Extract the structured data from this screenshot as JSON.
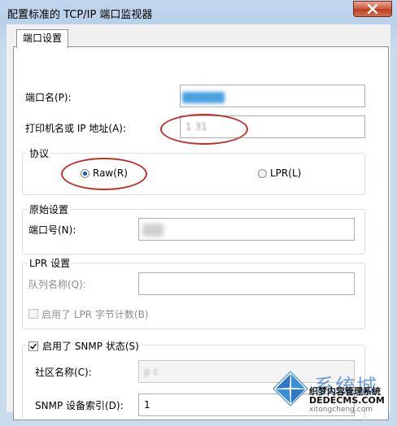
{
  "window": {
    "title": "配置标准的 TCP/IP 端口监视器"
  },
  "tabs": [
    {
      "label": "端口设置"
    }
  ],
  "port_name": {
    "label": "端口名(P):",
    "value": ""
  },
  "printer_address": {
    "label": "打印机名或 IP 地址(A):",
    "value": "1       31"
  },
  "protocol": {
    "title": "协议",
    "raw_label": "Raw(R)",
    "lpr_label": "LPR(L)",
    "selected": "Raw"
  },
  "raw_settings": {
    "title": "原始设置",
    "port_number_label": "端口号(N):",
    "port_number_value": ""
  },
  "lpr_settings": {
    "title": "LPR 设置",
    "queue_name_label": "队列名称(Q):",
    "queue_name_value": "",
    "byte_count_label": "启用了 LPR 字节计数(B)",
    "byte_count_checked": false
  },
  "snmp": {
    "enabled_label": "启用了 SNMP 状态(S)",
    "enabled_checked": true,
    "community_label": "社区名称(C):",
    "community_value": "p     c",
    "device_index_label": "SNMP 设备索引(D):",
    "device_index_value": "1"
  },
  "watermark": {
    "line1": "系统城",
    "line2": "织梦内容管理系统",
    "line3": "DEDECMS.COM",
    "line4": "xitongcheng.com"
  },
  "colors": {
    "annotation_red": "#c0302a",
    "selection_blue": "#1a58b3"
  }
}
